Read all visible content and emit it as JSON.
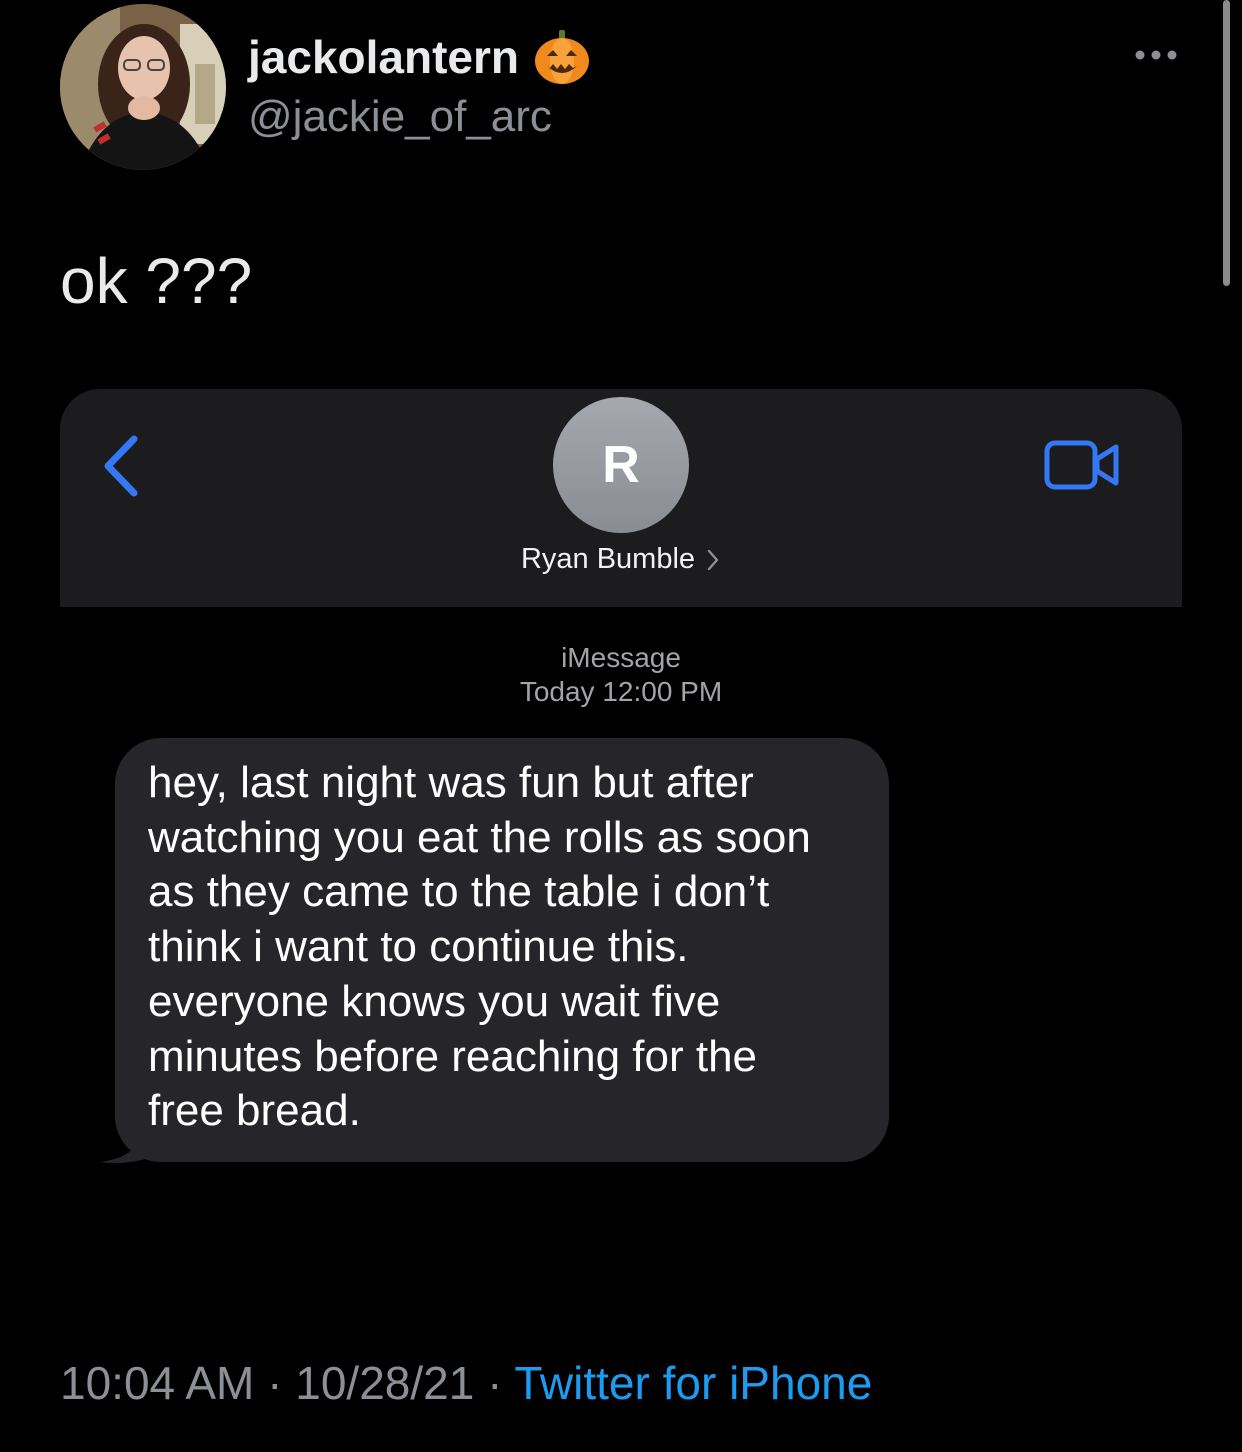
{
  "tweet": {
    "display_name": "jackolantern",
    "name_emoji": "pumpkin-icon",
    "handle": "@jackie_of_arc",
    "text": "ok ???",
    "time": "10:04 AM",
    "date": "10/28/21",
    "separator": "·",
    "source": "Twitter for iPhone"
  },
  "imessage": {
    "contact_initial": "R",
    "contact_name": "Ryan Bumble",
    "service": "iMessage",
    "timestamp": "Today 12:00 PM",
    "message_lines": [
      "hey, last night was fun but after",
      "watching you eat the rolls as soon",
      "as they came to the table i don’t",
      "think i want to continue this.",
      "everyone knows you wait five",
      "minutes before reaching for the",
      "free bread."
    ]
  },
  "colors": {
    "background": "#000000",
    "text_primary": "#e9eaeb",
    "text_secondary": "#8b9096",
    "link": "#1d9bf0",
    "imessage_header": "#1c1c1e",
    "bubble": "#26262a",
    "ios_blue": "#3478f6"
  },
  "icons": [
    "avatar",
    "pumpkin-icon",
    "more-icon",
    "back-chevron-icon",
    "video-call-icon",
    "disclosure-chevron-icon"
  ]
}
